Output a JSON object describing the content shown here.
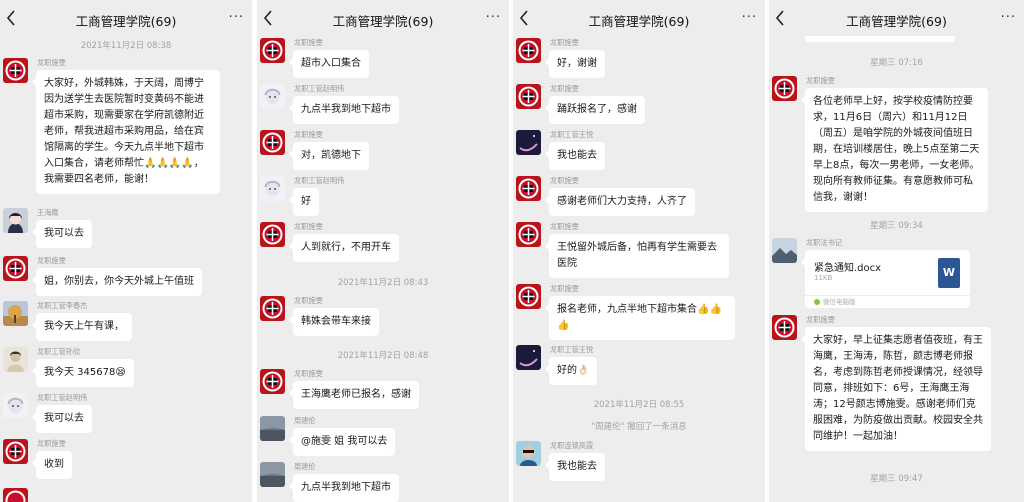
{
  "colors": {
    "panel_bg": "#ededed",
    "bubble": "#ffffff",
    "milan_red": "#b8151b",
    "word_blue": "#2b5797"
  },
  "header": {
    "title": "工商管理学院(69)",
    "more_label": "···"
  },
  "panel1": {
    "timestamp": "2021年11月2日 08:38",
    "messages": [
      {
        "name": "龙职施雯",
        "text": "大家好，外城韩姝，于天阔，周博宁因为送学生去医院暂时变黄码不能进超市采购，现需要家在学府凯德附近老师，帮我进超市采购用品，给在宾馆隔离的学生。今天九点半地下超市入口集合，请老师帮忙🙏🙏🙏🙏，我需要四名老师，能谢！"
      },
      {
        "name": "王海鹰",
        "text": "我可以去"
      },
      {
        "name": "龙职施雯",
        "text": "姐，你别去，你今天外城上午值班"
      },
      {
        "name": "龙职工管李春杰",
        "text": "我今天上午有课，"
      },
      {
        "name": "龙职工管孙欣",
        "text": "我今天 345678😪"
      },
      {
        "name": "龙职工管赵明伟",
        "text": "我可以去"
      },
      {
        "name": "龙职施雯",
        "text": "收到"
      }
    ]
  },
  "panel2": {
    "messages": [
      {
        "name": "龙职施雯",
        "text": "超市入口集合"
      },
      {
        "name": "龙职工管赵明伟",
        "text": "九点半我到地下超市"
      },
      {
        "name": "龙职施雯",
        "text": "对，凯德地下"
      },
      {
        "name": "龙职工管赵明伟",
        "text": "好"
      },
      {
        "name": "龙职施雯",
        "text": "人到就行，不用开车"
      },
      {
        "name": "龙职施雯",
        "text": "韩姝会带车来接"
      },
      {
        "name": "龙职施雯",
        "text": "王海鹰老师已报名，感谢"
      },
      {
        "name": "周建伦",
        "text": "@施雯 姐 我可以去"
      },
      {
        "name": "周建伦",
        "text": "九点半我到地下超市"
      }
    ],
    "timestamps": [
      "2021年11月2日 08:43",
      "2021年11月2日 08:48"
    ]
  },
  "panel3": {
    "messages": [
      {
        "name": "龙职施雯",
        "text": "好，谢谢"
      },
      {
        "name": "龙职施雯",
        "text": "踊跃报名了，感谢"
      },
      {
        "name": "龙职工管王悦",
        "text": "我也能去"
      },
      {
        "name": "龙职施雯",
        "text": "感谢老师们大力支持，人齐了"
      },
      {
        "name": "龙职施雯",
        "text": "王悦留外城后备，怕再有学生需要去医院"
      },
      {
        "name": "龙职施雯",
        "text": "报名老师，九点半地下超市集合👍👍👍"
      },
      {
        "name": "龙职工管王悦",
        "text": "好的👌🏻"
      },
      {
        "name": "龙职连锁高霞",
        "text": "我也能去"
      }
    ],
    "timestamp": "2021年11月2日 08:55",
    "recall": "\"周建伦\" 撤回了一条消息"
  },
  "panel4": {
    "timestamps": [
      "星期三 07:16",
      "星期三 09:34",
      "星期三 09:47"
    ],
    "messages": [
      {
        "name": "龙职施雯",
        "text": "各位老师早上好，按学校疫情防控要求，11月6日（周六）和11月12日（周五）是咱学院的外城夜间值班日期，在培训楼居住，晚上5点至第二天早上8点，每次一男老师，一女老师。现向所有教师征集。有意愿教师可私信我，谢谢！"
      },
      {
        "name": "龙职施雯",
        "text": "大家好，早上征集志愿者值夜班，有王海鹰，王海涛，陈哲，颜志博老师报名，考虑到陈哲老师授课情况，经领导同意，排班如下：6号，王海鹰王海涛；12号颜志博施雯。感谢老师们克服困难，为防疫做出贡献。校园安全共同维护！一起加油！"
      }
    ],
    "file": {
      "sender": "龙职法书记",
      "name": "紧急通知.docx",
      "size": "11KB",
      "source": "微信电脑版",
      "icon": "word-icon",
      "icon_letter": "W"
    }
  }
}
